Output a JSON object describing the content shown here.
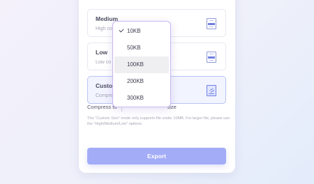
{
  "cards": [
    {
      "title": "Medium",
      "desc": "High co",
      "icon": "compress-medium-icon"
    },
    {
      "title": "Low",
      "desc": "Low co",
      "icon": "compress-low-icon"
    },
    {
      "title": "Custo",
      "desc": "Compre",
      "icon": "edit-icon"
    }
  ],
  "compress": {
    "label": "Compress to",
    "value": "10KB",
    "suffix": "size"
  },
  "note": "The \"Custom Size\" mode only supports file under 10MB. For larger file, please use the \"High/Medium/Low\" options.",
  "export_label": "Export",
  "dropdown": {
    "options": [
      "10KB",
      "50KB",
      "100KB",
      "200KB",
      "300KB"
    ],
    "selected": "10KB",
    "hovered": "100KB"
  },
  "colors": {
    "accent": "#a3acf7",
    "dropdown_border": "#c9b7f1",
    "selected_card_bg": "#f2f4ff"
  }
}
